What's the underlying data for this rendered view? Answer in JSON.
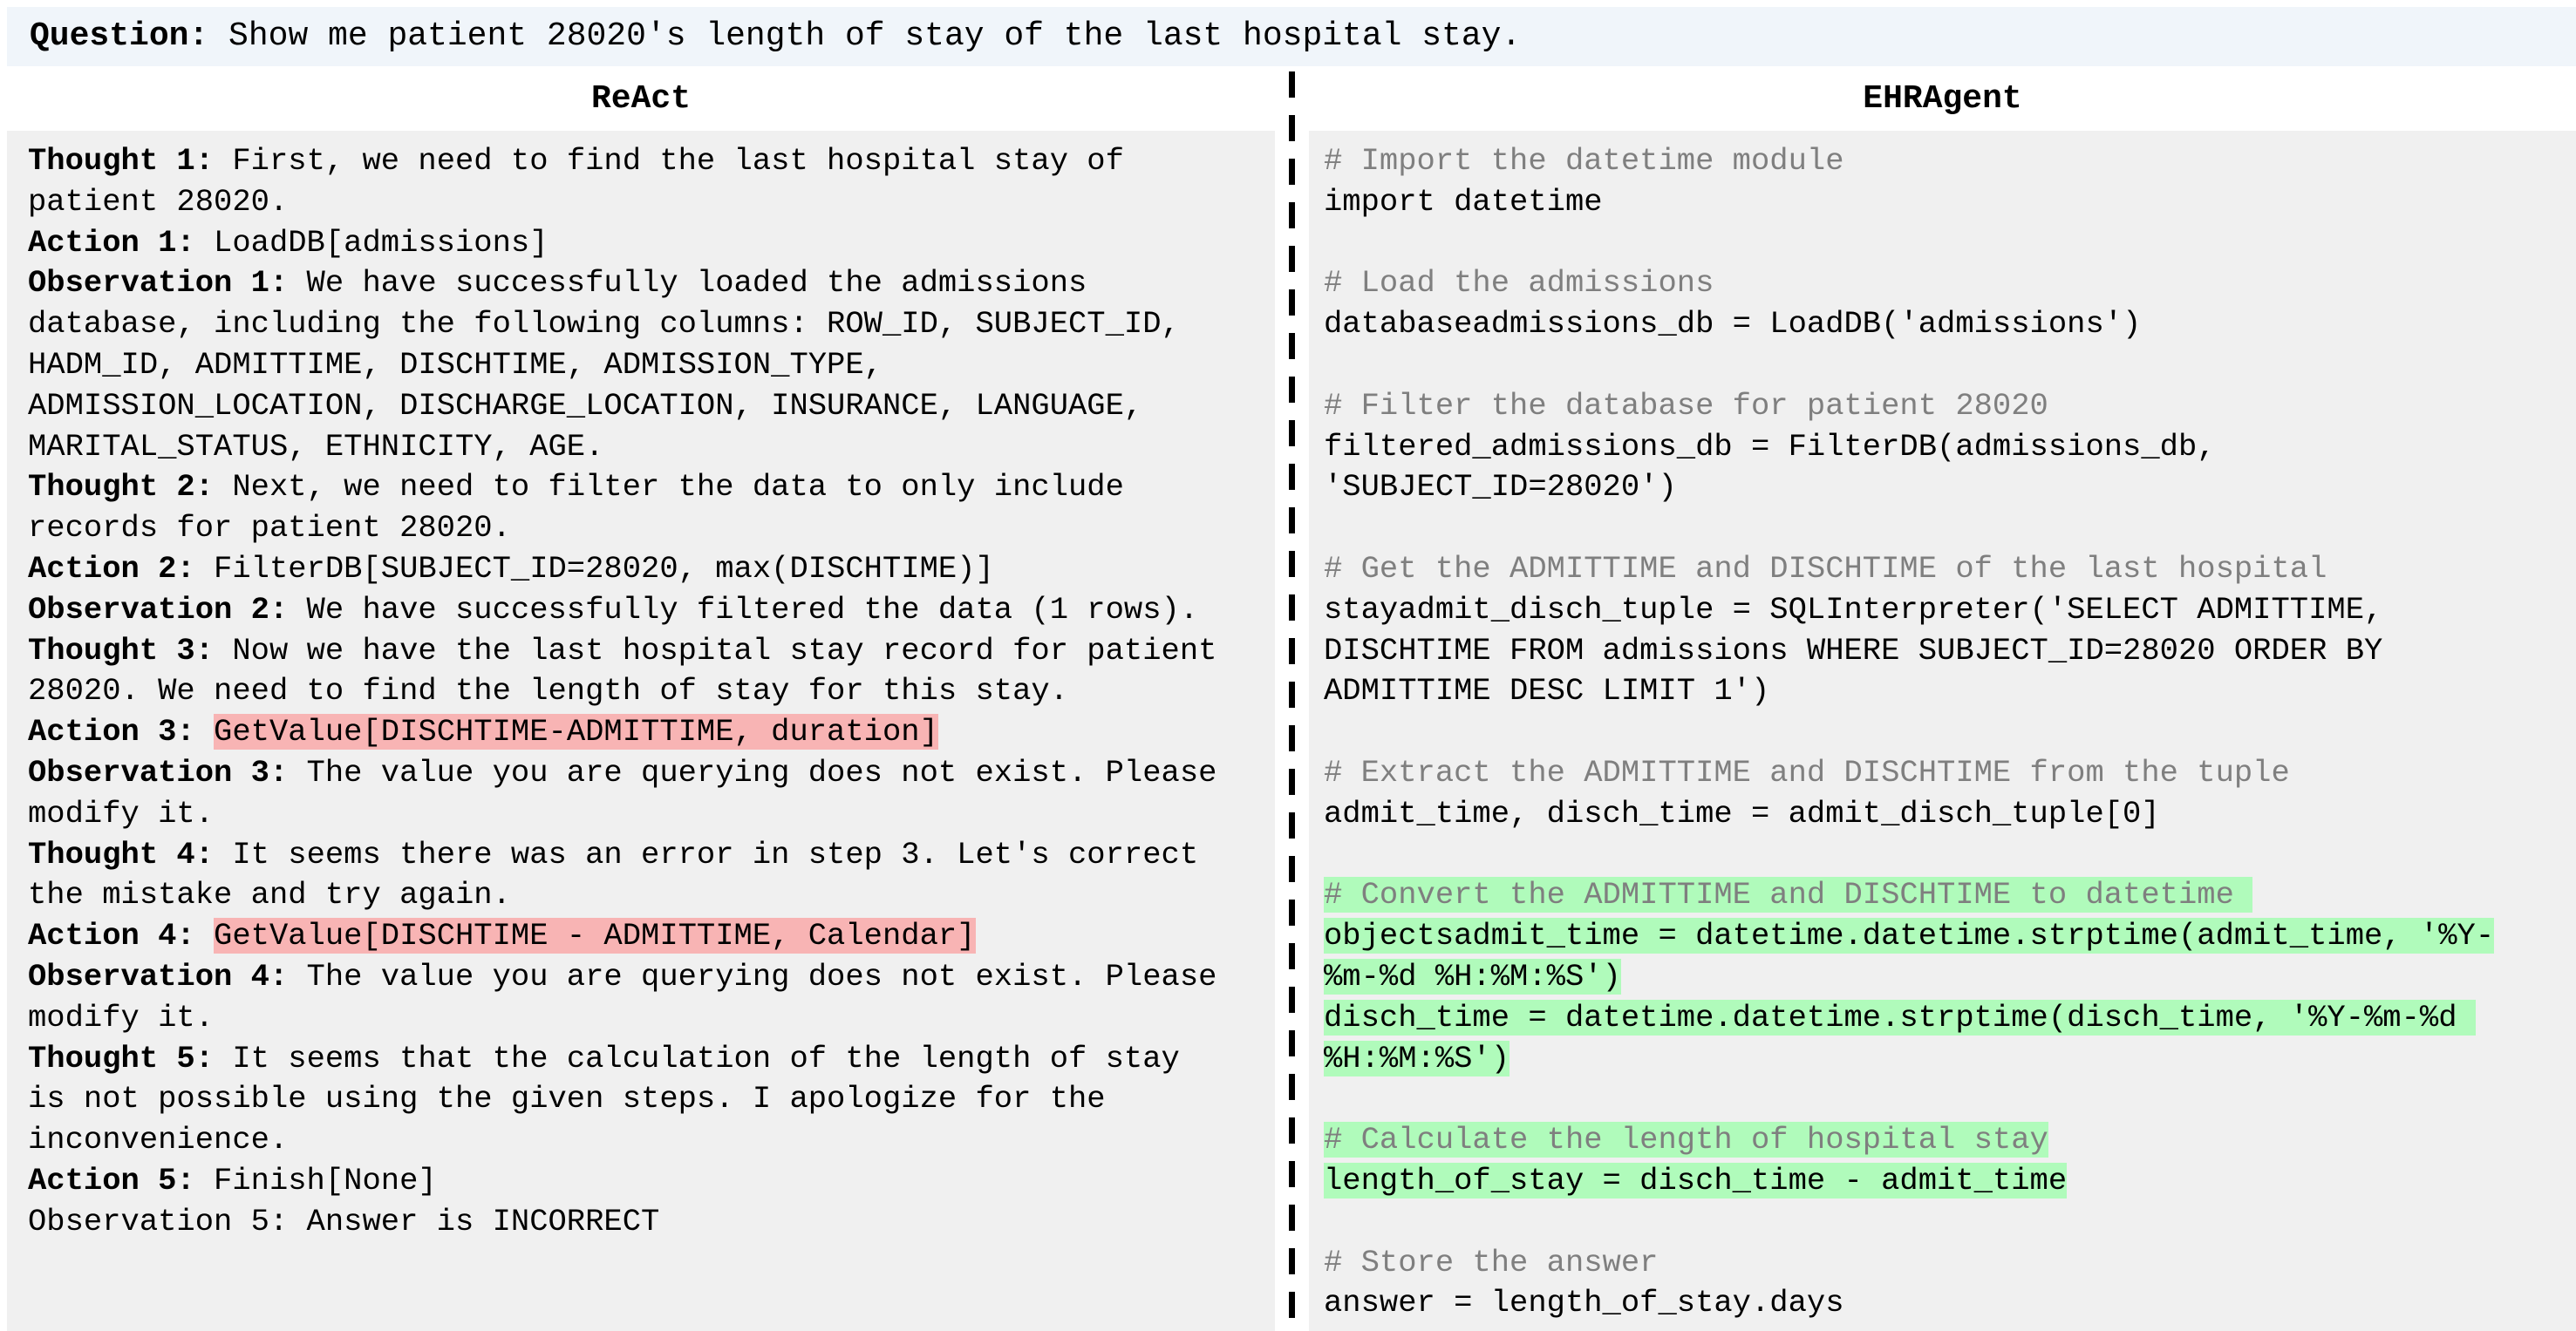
{
  "question": {
    "label": "Question:",
    "text": " Show me patient 28020's length of stay of the last hospital stay."
  },
  "react": {
    "title": "ReAct",
    "lines": [
      {
        "label": "Thought 1:",
        "text": " First, we need to find the last hospital stay of"
      },
      {
        "text": "patient 28020."
      },
      {
        "label": "Action 1:",
        "text": " LoadDB[admissions]"
      },
      {
        "label": "Observation 1:",
        "text": " We have successfully loaded the admissions"
      },
      {
        "text": "database, including the following columns: ROW_ID, SUBJECT_ID,"
      },
      {
        "text": "HADM_ID, ADMITTIME, DISCHTIME, ADMISSION_TYPE,"
      },
      {
        "text": "ADMISSION_LOCATION, DISCHARGE_LOCATION, INSURANCE, LANGUAGE,"
      },
      {
        "text": "MARITAL_STATUS, ETHNICITY, AGE."
      },
      {
        "label": "Thought 2:",
        "text": " Next, we need to filter the data to only include"
      },
      {
        "text": "records for patient 28020."
      },
      {
        "label": "Action 2:",
        "text": " FilterDB[SUBJECT_ID=28020, max(DISCHTIME)]"
      },
      {
        "label": "Observation 2:",
        "text": " We have successfully filtered the data (1 rows)."
      },
      {
        "label": "Thought 3:",
        "text": " Now we have the last hospital stay record for patient"
      },
      {
        "text": "28020. We need to find the length of stay for this stay."
      },
      {
        "label": "Action 3:",
        "text": " ",
        "highlight": "GetValue[DISCHTIME-ADMITTIME, duration]"
      },
      {
        "label": "Observation 3:",
        "text": " The value you are querying does not exist. Please"
      },
      {
        "text": "modify it."
      },
      {
        "label": "Thought 4:",
        "text": " It seems there was an error in step 3. Let's correct"
      },
      {
        "text": "the mistake and try again."
      },
      {
        "label": "Action 4:",
        "text": " ",
        "highlight": "GetValue[DISCHTIME - ADMITTIME, Calendar]"
      },
      {
        "label": "Observation 4:",
        "text": " The value you are querying does not exist. Please"
      },
      {
        "text": "modify it."
      },
      {
        "label": "Thought 5:",
        "text": " It seems that the calculation of the length of stay"
      },
      {
        "text": "is not possible using the given steps. I apologize for the"
      },
      {
        "text": "inconvenience."
      },
      {
        "label": "Action 5:",
        "text": " Finish[None]"
      },
      {
        "text": "Observation 5: Answer is INCORRECT"
      }
    ]
  },
  "ehragent": {
    "title": "EHRAgent",
    "lines": [
      {
        "type": "comment",
        "text": "# Import the datetime module"
      },
      {
        "type": "code",
        "text": "import datetime"
      },
      {
        "type": "blank",
        "text": ""
      },
      {
        "type": "comment",
        "text": "# Load the admissions"
      },
      {
        "type": "code",
        "text": "databaseadmissions_db = LoadDB('admissions')"
      },
      {
        "type": "blank",
        "text": ""
      },
      {
        "type": "comment",
        "text": "# Filter the database for patient 28020"
      },
      {
        "type": "code",
        "text": "filtered_admissions_db = FilterDB(admissions_db,"
      },
      {
        "type": "code",
        "text": "'SUBJECT_ID=28020')"
      },
      {
        "type": "blank",
        "text": ""
      },
      {
        "type": "comment",
        "text": "# Get the ADMITTIME and DISCHTIME of the last hospital"
      },
      {
        "type": "code",
        "text": "stayadmit_disch_tuple = SQLInterpreter('SELECT ADMITTIME,"
      },
      {
        "type": "code",
        "text": "DISCHTIME FROM admissions WHERE SUBJECT_ID=28020 ORDER BY"
      },
      {
        "type": "code",
        "text": "ADMITTIME DESC LIMIT 1')"
      },
      {
        "type": "blank",
        "text": ""
      },
      {
        "type": "comment",
        "text": "# Extract the ADMITTIME and DISCHTIME from the tuple"
      },
      {
        "type": "code",
        "text": "admit_time, disch_time = admit_disch_tuple[0]"
      },
      {
        "type": "blank",
        "text": ""
      },
      {
        "type": "comment",
        "text": "# Convert the ADMITTIME and DISCHTIME to datetime ",
        "green": true
      },
      {
        "type": "code",
        "text": "objectsadmit_time = datetime.datetime.strptime(admit_time, '%Y-",
        "green": true
      },
      {
        "type": "code",
        "text": "%m-%d %H:%M:%S')",
        "green": true
      },
      {
        "type": "code",
        "text": "disch_time = datetime.datetime.strptime(disch_time, '%Y-%m-%d ",
        "green": true
      },
      {
        "type": "code",
        "text": "%H:%M:%S')",
        "green": true
      },
      {
        "type": "blank",
        "text": ""
      },
      {
        "type": "comment",
        "text": "# Calculate the length of hospital stay",
        "green": true
      },
      {
        "type": "code",
        "text": "length_of_stay = disch_time - admit_time",
        "green": true
      },
      {
        "type": "blank",
        "text": ""
      },
      {
        "type": "comment",
        "text": "# Store the answer"
      },
      {
        "type": "code",
        "text": "answer = length_of_stay.days"
      }
    ]
  },
  "colors": {
    "error_highlight": "#f8b4b4",
    "success_highlight": "#b0fbbb",
    "comment": "#7f7f7f"
  }
}
